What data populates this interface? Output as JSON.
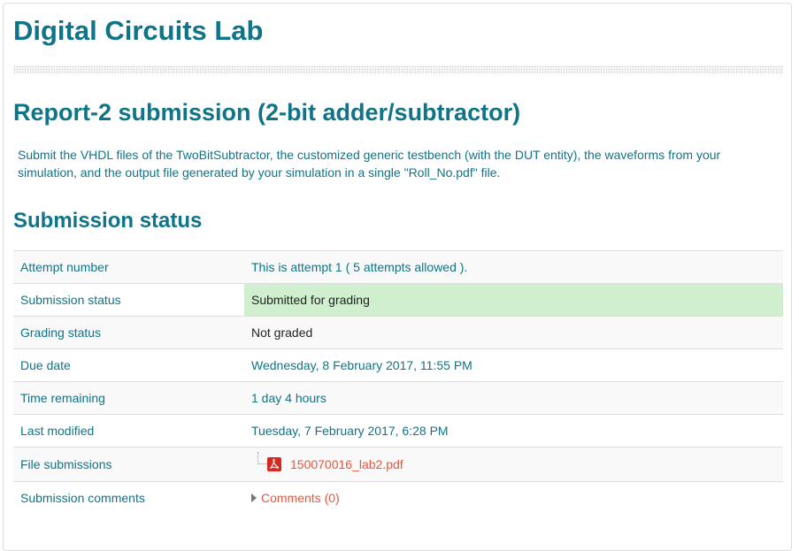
{
  "course": {
    "title": "Digital Circuits Lab"
  },
  "assignment": {
    "title": "Report-2 submission (2-bit adder/subtractor)",
    "intro": "Submit the VHDL files of the TwoBitSubtractor, the customized generic testbench (with the DUT entity), the waveforms from your simulation, and the output file generated by your simulation in a single \"Roll_No.pdf\" file."
  },
  "submission": {
    "heading": "Submission status",
    "rows": [
      {
        "label": "Attempt number",
        "value": "This is attempt 1 ( 5 attempts allowed )."
      },
      {
        "label": "Submission status",
        "value": "Submitted for grading"
      },
      {
        "label": "Grading status",
        "value": "Not graded"
      },
      {
        "label": "Due date",
        "value": "Wednesday, 8 February 2017, 11:55 PM"
      },
      {
        "label": "Time remaining",
        "value": "1 day 4 hours"
      },
      {
        "label": "Last modified",
        "value": "Tuesday, 7 February 2017, 6:28 PM"
      },
      {
        "label": "File submissions",
        "value": "150070016_lab2.pdf",
        "icon": "pdf-file-icon"
      },
      {
        "label": "Submission comments",
        "value": "Comments (0)",
        "icon": "collapsed-caret-icon"
      }
    ]
  },
  "colors": {
    "heading": "#0f7488",
    "link": "#e8553e",
    "success_bg": "#cfefcf"
  }
}
